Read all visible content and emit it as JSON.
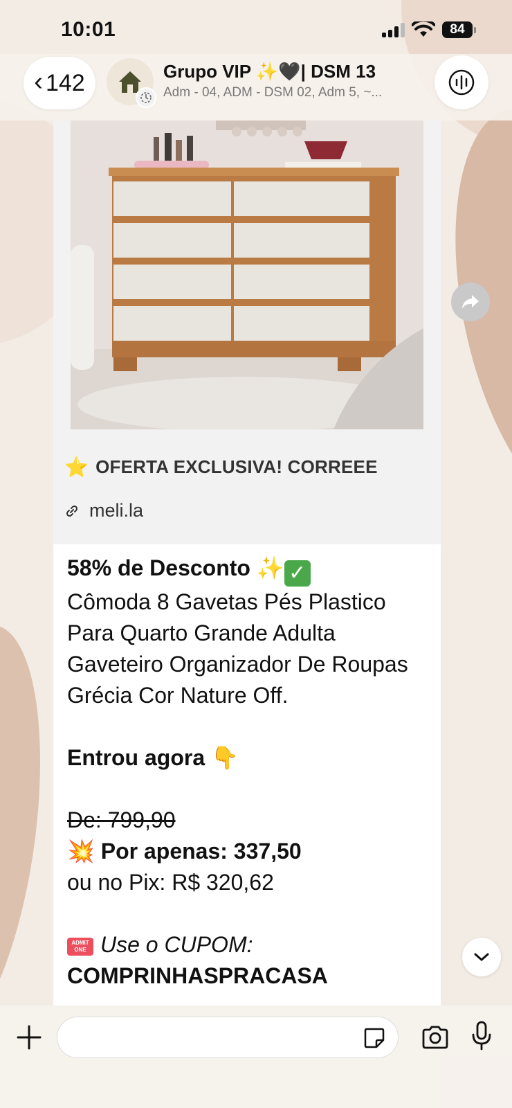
{
  "status_bar": {
    "time": "10:01",
    "battery": "84"
  },
  "header": {
    "back_count": "142",
    "group_title": "Grupo VIP ✨🖤|  DSM 13",
    "group_subtitle": "Adm - 04, ADM - DSM 02, Adm 5, ~...",
    "avatar_icon": "house-icon",
    "summary_icon": "waveform-icon"
  },
  "message": {
    "preview": {
      "title": "OFERTA EXCLUSIVA! CORREEE",
      "star": "⭐",
      "link": "meli.la"
    },
    "discount": "58% de Desconto",
    "sparkle": "✨",
    "check": "✓",
    "product_name": "Cômoda 8 Gavetas Pés Plastico Para Quarto Grande Adulta Gaveteiro Organizador De Roupas Grécia Cor Nature Off.",
    "entrou": "Entrou agora",
    "point": "👇",
    "old_price": "De: 799,90",
    "boom": "💥",
    "price": "Por apenas: 337,50",
    "pix_price": "ou no Pix: R$  320,62",
    "ticket_label": "ADMIT ONE",
    "coupon_label": "Use o CUPOM:",
    "coupon_code": "COMPRINHASPRACASA"
  },
  "composer": {
    "placeholder": ""
  },
  "colors": {
    "wallpaper": "#f3ece5",
    "accent_blob": "#d8b9a6",
    "bubble": "#ffffff",
    "preview_bg": "#f2f2f2"
  }
}
